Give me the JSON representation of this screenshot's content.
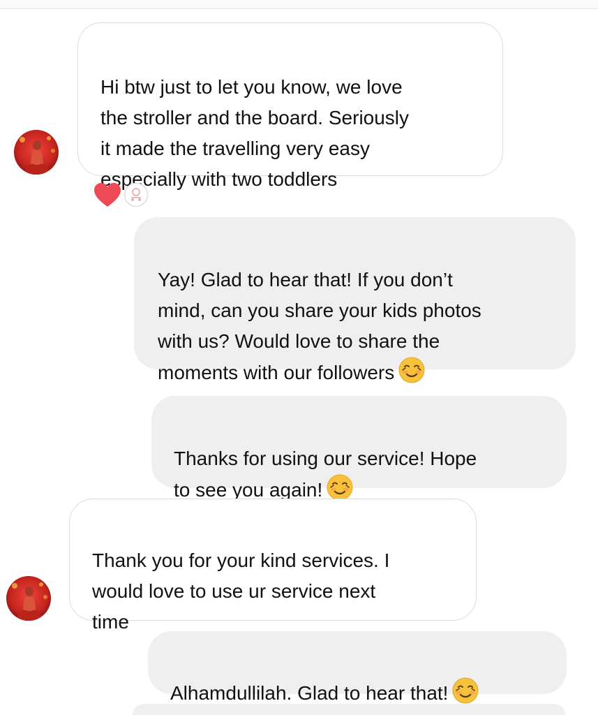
{
  "thread": {
    "messages": [
      {
        "sender": "other",
        "text": "Hi btw just to let you know, we love\nthe stroller and the board. Seriously\nit made the travelling very easy\nespecially with two toddlers",
        "reactions": [
          "heart-icon",
          "page-avatar-icon"
        ]
      },
      {
        "sender": "me",
        "text": "Yay! Glad to hear that! If you don’t\nmind, can you share your kids photos\nwith us? Would love to share the\nmoments with our followers",
        "emoji": "smiling-face-icon"
      },
      {
        "sender": "me",
        "text": "Thanks for using our service! Hope\nto see you again!",
        "emoji": "smiling-face-icon"
      },
      {
        "sender": "other",
        "text": "Thank you for your kind services. I\nwould love to use ur service next\ntime"
      },
      {
        "sender": "me",
        "text": "Alhamdullilah. Glad to hear that!",
        "emoji": "smiling-face-icon"
      }
    ]
  },
  "colors": {
    "heart": "#ed4956",
    "outgoing_bubble": "#efefef",
    "incoming_border": "#dcdcdc",
    "emoji_face": "#f7c23a"
  }
}
